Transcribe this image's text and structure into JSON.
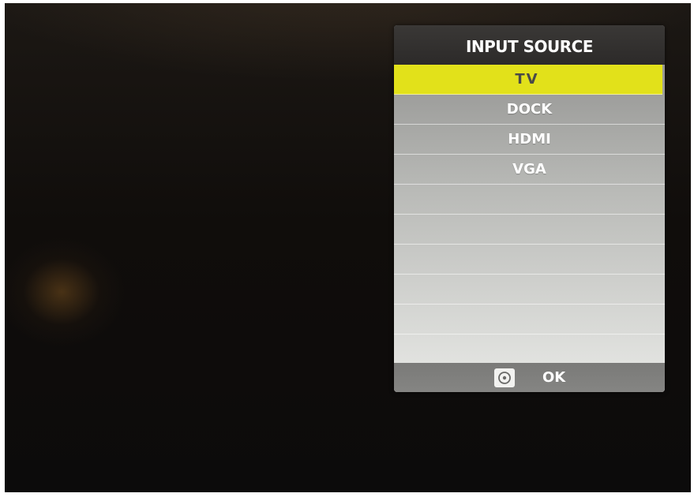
{
  "menu": {
    "title": "INPUT SOURCE",
    "items": [
      {
        "label": "TV",
        "selected": true
      },
      {
        "label": "DOCK",
        "selected": false
      },
      {
        "label": "HDMI",
        "selected": false
      },
      {
        "label": "VGA",
        "selected": false
      }
    ],
    "empty_row_count_visible": 6,
    "selection_color": "#e2e11a",
    "footer": {
      "icon": "circle-dot-icon",
      "label": "OK"
    }
  }
}
